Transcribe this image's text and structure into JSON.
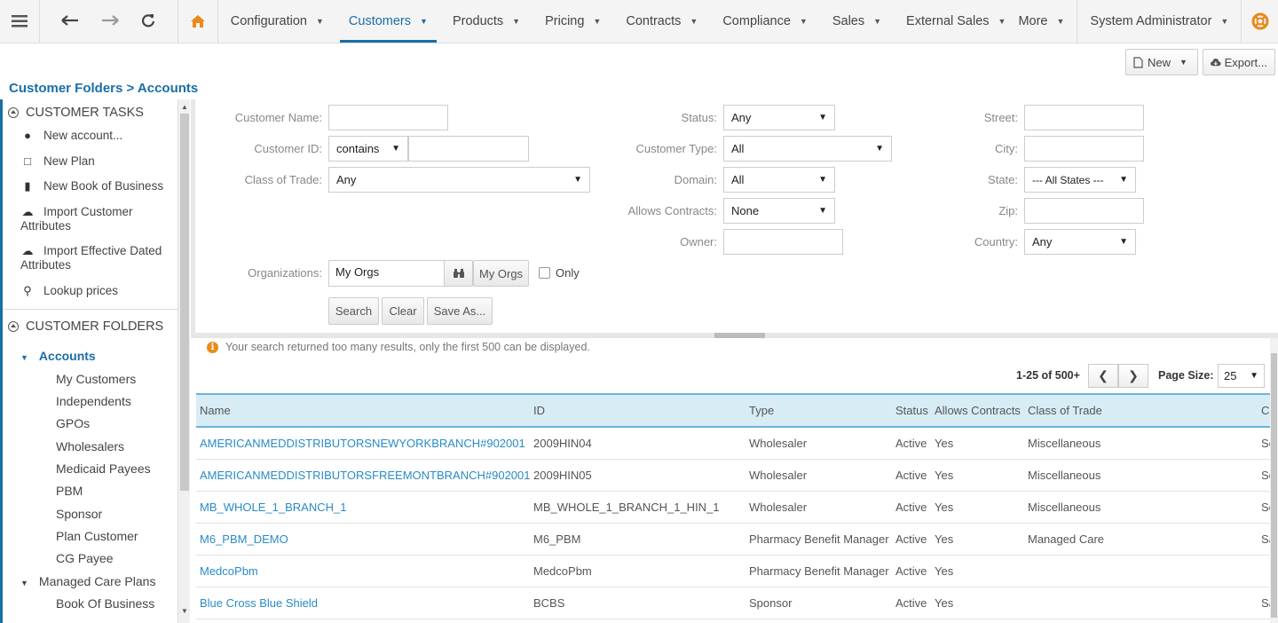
{
  "nav": {
    "menus": [
      {
        "label": "Configuration",
        "active": false
      },
      {
        "label": "Customers",
        "active": true
      },
      {
        "label": "Products",
        "active": false
      },
      {
        "label": "Pricing",
        "active": false
      },
      {
        "label": "Contracts",
        "active": false
      },
      {
        "label": "Compliance",
        "active": false
      },
      {
        "label": "Sales",
        "active": false
      },
      {
        "label": "External Sales",
        "active": false
      },
      {
        "label": "More",
        "active": false
      }
    ],
    "user": "System Administrator",
    "accent_color": "#1a6ea8",
    "home_color": "#e98a1b"
  },
  "header": {
    "new_label": "New",
    "export_label": "Export...",
    "breadcrumb": "Customer Folders > Accounts"
  },
  "sidebar": {
    "tasks_title": "CUSTOMER TASKS",
    "tasks": [
      {
        "label": "New account...",
        "icon": "user-icon"
      },
      {
        "label": "New Plan",
        "icon": "document-icon"
      },
      {
        "label": "New Book of Business",
        "icon": "book-icon"
      },
      {
        "label": "Import Customer Attributes",
        "icon": "cloud-upload-icon"
      },
      {
        "label": "Import Effective Dated Attributes",
        "icon": "cloud-upload-icon"
      },
      {
        "label": "Lookup prices",
        "icon": "search-icon"
      }
    ],
    "folders_title": "CUSTOMER FOLDERS",
    "folders": {
      "root": "Accounts",
      "children": [
        "My Customers",
        "Independents",
        "GPOs",
        "Wholesalers",
        "Medicaid Payees",
        "PBM",
        "Sponsor",
        "Plan Customer",
        "CG Payee"
      ],
      "group2": "Managed Care Plans",
      "group2_children": [
        "Book Of Business"
      ]
    }
  },
  "form": {
    "customer_name_label": "Customer Name:",
    "customer_id_label": "Customer ID:",
    "customer_id_op": "contains",
    "class_of_trade_label": "Class of Trade:",
    "class_of_trade_value": "Any",
    "status_label": "Status:",
    "status_value": "Any",
    "customer_type_label": "Customer Type:",
    "customer_type_value": "All",
    "domain_label": "Domain:",
    "domain_value": "All",
    "allows_contracts_label": "Allows Contracts:",
    "allows_contracts_value": "None",
    "owner_label": "Owner:",
    "street_label": "Street:",
    "city_label": "City:",
    "state_label": "State:",
    "state_value": "--- All States ---",
    "zip_label": "Zip:",
    "country_label": "Country:",
    "country_value": "Any",
    "organizations_label": "Organizations:",
    "organizations_value": "My Orgs",
    "my_orgs_button": "My Orgs",
    "only_label": "Only",
    "search_button": "Search",
    "clear_button": "Clear",
    "save_as_button": "Save As..."
  },
  "results": {
    "notice": "Your search returned too many results, only the first 500 can be displayed.",
    "range": "1-25 of 500+",
    "page_size_label": "Page Size:",
    "page_size": "25",
    "columns": [
      "Name",
      "ID",
      "Type",
      "Status",
      "Allows Contracts",
      "Class of Trade",
      "Ci"
    ],
    "rows": [
      {
        "name": "AMERICANMEDDISTRIBUTORSNEWYORKBRANCH#902001",
        "id": "2009HIN04",
        "type": "Wholesaler",
        "status": "Active",
        "allows": "Yes",
        "cot": "Miscellaneous",
        "city": "So"
      },
      {
        "name": "AMERICANMEDDISTRIBUTORSFREEMONTBRANCH#902001",
        "id": "2009HIN05",
        "type": "Wholesaler",
        "status": "Active",
        "allows": "Yes",
        "cot": "Miscellaneous",
        "city": "So"
      },
      {
        "name": "MB_WHOLE_1_BRANCH_1",
        "id": "MB_WHOLE_1_BRANCH_1_HIN_1",
        "type": "Wholesaler",
        "status": "Active",
        "allows": "Yes",
        "cot": "Miscellaneous",
        "city": "So"
      },
      {
        "name": "M6_PBM_DEMO",
        "id": "M6_PBM",
        "type": "Pharmacy Benefit Manager",
        "status": "Active",
        "allows": "Yes",
        "cot": "Managed Care",
        "city": "Sa"
      },
      {
        "name": "MedcoPbm",
        "id": "MedcoPbm",
        "type": "Pharmacy Benefit Manager",
        "status": "Active",
        "allows": "Yes",
        "cot": "",
        "city": ""
      },
      {
        "name": "Blue Cross Blue Shield",
        "id": "BCBS",
        "type": "Sponsor",
        "status": "Active",
        "allows": "Yes",
        "cot": "",
        "city": "Sa"
      }
    ]
  }
}
